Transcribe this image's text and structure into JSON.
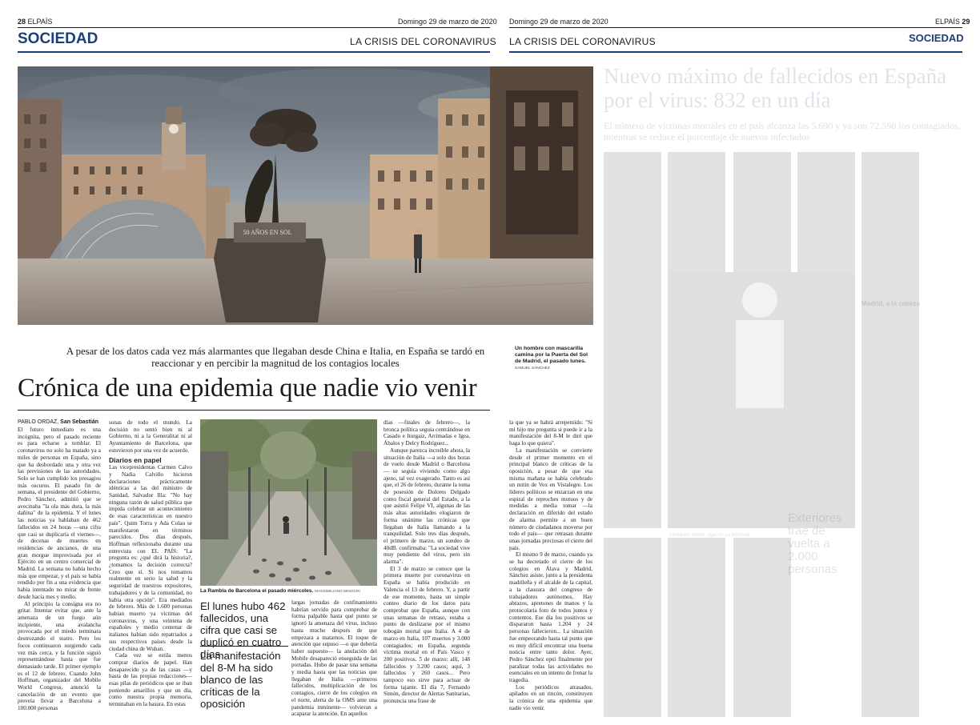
{
  "left_page": {
    "page_number": "28",
    "newspaper": "ELPAÍS",
    "date": "Domingo 29 de marzo de 2020",
    "section": "SOCIEDAD",
    "topic": "LA CRISIS DEL CORONAVIRUS",
    "photo_monument_text": "50 AÑOS EN SOL",
    "photo_caption": "Un hombre con mascarilla camina por la Puerta del Sol de Madrid, el pasado lunes.",
    "photo_credit": "SAMUEL SÁNCHEZ",
    "subhead": "A pesar de los datos cada vez más alarmantes que llegaban desde China e Italia, en España se tardó en reaccionar y en percibir la magnitud de los contagios locales",
    "headline": "Crónica de una epidemia que nadie vio venir",
    "byline_author": "PABLO ORDAZ,",
    "byline_place": "San Sebastián",
    "col1": "El futuro inmediato es una incógnita, pero el pasado reciente es para echarse a temblar. El coronavirus no solo ha matado ya a miles de personas en España, sino que ha desbordado una y otra vez las previsiones de las autoridades. Solo se han cumplido los presagios más oscuros. El pasado fin de semana, el presidente del Gobierno, Pedro Sánchez, admitió que se avecinaba \"la ola más dura, la más dañina\" de la epidemia. Y el lunes las noticias ya hablaban de 462 fallecidos en 24 horas —una cifra que casi se duplicaría el viernes—, de decenas de muertes en residencias de ancianos, de una gran morgue improvisada por el Ejército en un centro comercial de Madrid. La semana no había hecho más que empezar, y el país se había rendido por fin a una evidencia que había intentado no mirar de frente desde hacía mes y medio.",
    "col1b": "Al principio la consigna era no gritar. Intentar evitar que, ante la amenaza de un fuego aún incipiente, una avalancha provocada por el miedo terminara destrozando el teatro. Pero los focos continuaron surgiendo cada vez más cerca, y la función siguió representándose hasta que fue demasiado tarde. El primer ejemplo es el 12 de febrero. Cuando John Hoffman, organizador del Mobile World Congress, anunció la cancelación de un evento que preveía llevar a Barcelona a 100.000 personas",
    "col2": "sonas de todo el mundo. La decisión no sentó bien ni al Gobierno, ni a la Generalitat ni al Ayuntamiento de Barcelona, que estuvieron por una vez de acuerdo.",
    "col2_heading": "Diarios en papel",
    "col2b": "Las vicepresidentas Carmen Calvo y Nadia Calviño hicieron declaraciones prácticamente idénticas a las del ministro de Sanidad, Salvador Illa: \"No hay ninguna razón de salud pública que impida celebrar un acontecimiento de esas características en nuestro país\". Quim Torra y Ada Colau se manifestaron en términos parecidos. Dos días después, Hoffman reflexionaba durante una entrevista con EL PAÍS: \"La pregunta es: ¿qué dirá la historia?, ¿tomamos la decisión correcta? Creo que sí. Si nos tomamos realmente en serio la salud y la seguridad de nuestros expositores, trabajadores y de la comunidad, no había otra opción\". Era mediados de febrero. Más de 1.600 personas habían muerto ya víctimas del coronavirus, y una veintena de españoles y medio centenar de italianos habían sido repatriados a sus respectivos países desde la ciudad china de Wuhan.",
    "col2c": "Cada vez se estila menos comprar diarios de papel. Han desaparecido ya de las casas —y hasta de las propias redacciones— esas pilas de periódicos que se iban poniendo amarillos y que un día, como nuestra propia memoria, terminaban en la basura. En estas",
    "rambla_caption": "La Rambla de Barcelona el pasado miércoles.",
    "rambla_credit": "MASSIMILIANO MINOCRI",
    "pull1": "El lunes hubo 462 fallecidos, una cifra que casi se duplicó en cuatro días",
    "pull2": "La manifestación del 8-M ha sido blanco de las críticas de la oposición",
    "col4": "largas jornadas de confinamiento habrían servido para comprobar de forma palpable hasta qué punto se ignoró la amenaza del virus, incluso hasta mucho después de que empezara a matarnos. El toque de atención que supuso —o que debería haber supuesto— la anulación del Mobile desapareció enseguida de las portadas. Hubo de pasar una semana y media hasta que las noticias que llegaban de Italia —primeros fallecidos, multiplicación de los contagios, cierre de los colegios en el norte, alerta de la OMS ante una pandemia inminente— volvieran a acaparar la atención. En aquellos",
    "col5": "días —finales de febrero—, la bronca política seguía centrándose en Casado e Iturgaiz, Arrimadas e Igea, Ábalos y Delcy Rodríguez...",
    "col5b": "Aunque parezca increíble ahora, la situación de Italia —a solo dos horas de vuelo desde Madrid o Barcelona— se seguía viviendo como algo ajeno, tal vez exagerado. Tanto es así que, el 26 de febrero, durante la toma de posesión de Dolores Delgado como fiscal general del Estado, a la que asistió Felipe VI, algunas de las más altas autoridades elogiaron de forma unánime las crónicas que llegaban de Italia llamando a la tranquilidad. Solo tres días después, el primero de marzo, un sondeo de 40dB. confirmaba: \"La sociedad vive muy pendiente del virus, pero sin alarma\".",
    "col5c": "El 3 de marzo se conoce que la primera muerte por coronavirus en España se había producido en Valencia el 13 de febrero. Y, a partir de ese momento, hasta un simple conteo diario de los datos para comprobar que España, aunque con unas semanas de retraso, estaba a punto de deslizarse por el mismo tobogán mortal que Italia. A 4 de marzo en Italia, 107 muertos y 3.000 contagiados; en España, segunda víctima mortal en el País Vasco y 200 positivos. 5 de marzo: allí, 148 fallecidos y 3.200 casos; aquí, 3 fallecidos y 260 casos... Pero tampoco eso sirve para actuar de forma tajante. El día 7, Fernando Simón, director de Alertas Sanitarias, pronuncia una frase de"
  },
  "right_page": {
    "page_number": "29",
    "newspaper": "ELPAÍS",
    "date": "Domingo 29 de marzo de 2020",
    "section": "SOCIEDAD",
    "topic": "LA CRISIS DEL CORONAVIRUS",
    "col1": "la que ya se habrá arrepentido: \"Si mi hijo me pregunta si puede ir a la manifestación del 8-M le diré que haga lo que quiera\".",
    "col1b": "La manifestación se convierte desde el primer momento en el principal blanco de críticas de la oposición, a pesar de que esa misma mañana se había celebrado un mitin de Vox en Vistalegre. Los líderes políticos se enzarzan en una espiral de reproches mutuos y de medidas a media tomar —la declaración en diferido del estado de alarma permite a un buen número de ciudadanos moverse por todo el país— que retrasan durante unas jornadas preciosas el cierre del país.",
    "col1c": "El mismo 9 de marzo, cuando ya se ha decretado el cierre de los colegios en Álava y Madrid, Sánchez asiste, junto a la presidenta madrileña y el alcalde de la capital, a la clausura del congreso de trabajadores autónomos. Hay abrazos, apretones de manos y la protocolaria foto de todos juntos y contentos. Ese día los positivos se dispararon hasta 1.204 y 24 personas fallecieron... La situación fue empeorando hasta tal punto que es muy difícil encontrar una buena noticia entre tanto dolor. Ayer, Pedro Sánchez optó finalmente por paralizar todas las actividades no esenciales en un intento de frenar la tragedia.",
    "col1d": "Los periódicos atrasados, apilados en un rincón, constituyen la crónica de una epidemia que nadie vio venir.",
    "faded_headline": "Nuevo máximo de fallecidos en España por el virus: 832 en un día",
    "faded_subhead": "El número de víctimas mortales en el país alcanza las 5.690 y ya son 72.598 los contagiados, mientras se reduce el porcentaje de nuevos infectados",
    "faded_box_title": "Exteriores trae de vuelta a 2.000 personas",
    "faded_heading_1": "Madrid, a la cabeza",
    "faded_photo_caption": "Fernando Simón, ayer en La Moncloa"
  }
}
